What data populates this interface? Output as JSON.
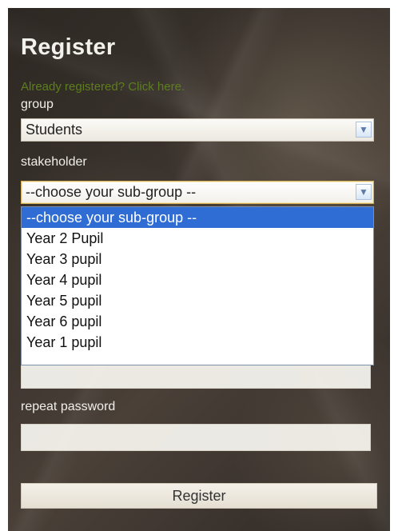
{
  "form": {
    "title": "Register",
    "login_link": "Already registered? Click here.",
    "group_label": "group",
    "group_value": "Students",
    "stakeholder_label": "stakeholder",
    "stakeholder_value": "--choose your sub-group --",
    "dropdown_options": [
      "--choose your sub-group --",
      "Year 2 Pupil",
      "Year 3 pupil",
      "Year 4 pupil",
      "Year 5 pupil",
      "Year 6 pupil",
      "Year 1 pupil"
    ],
    "repeat_password_label": "repeat password",
    "register_button": "Register"
  },
  "icons": {
    "dropdown_arrow": "chevron-down-icon"
  },
  "colors": {
    "link": "#5d7f1c",
    "selected_option": "#2f6cd3",
    "panel": "#3a332d"
  }
}
